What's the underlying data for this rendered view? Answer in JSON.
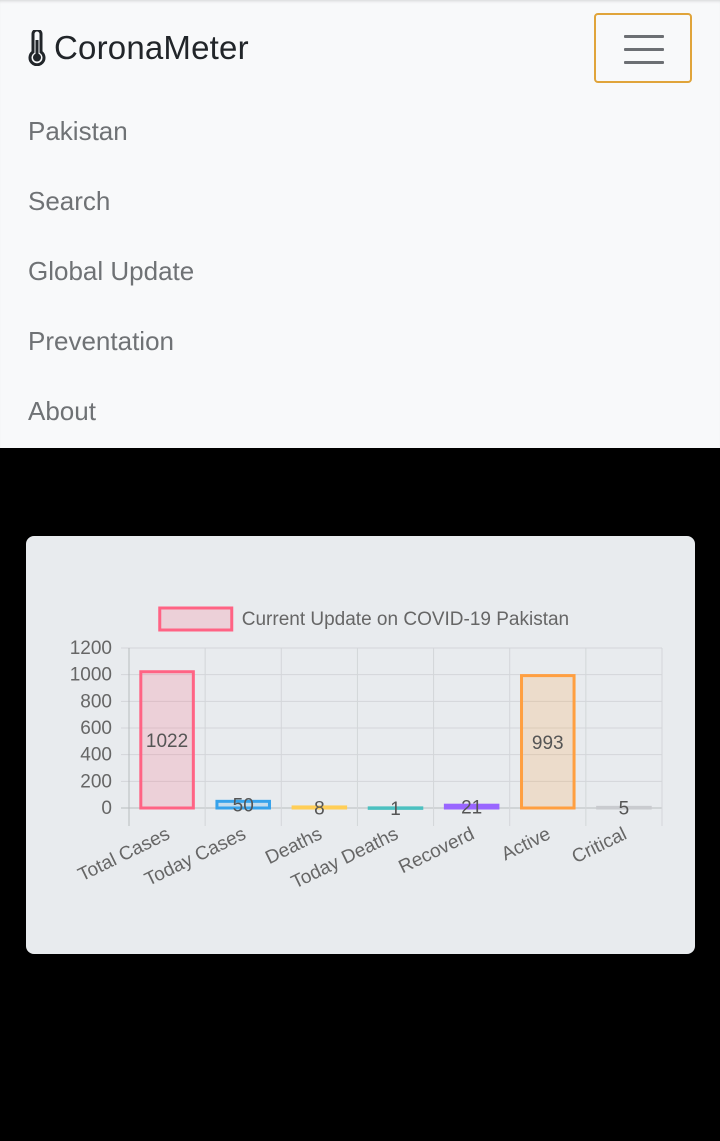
{
  "app": {
    "brand": "CoronaMeter",
    "brand_icon": "thermometer-icon",
    "menu_icon": "hamburger-menu-icon",
    "accent": "#e0a43a"
  },
  "nav": {
    "items": [
      {
        "label": "Pakistan"
      },
      {
        "label": "Search"
      },
      {
        "label": "Global Update"
      },
      {
        "label": "Preventation"
      },
      {
        "label": "About"
      }
    ]
  },
  "chart_data": {
    "type": "bar",
    "legend": "Current Update on COVID-19 Pakistan",
    "legend_position": "top",
    "categories": [
      "Total Cases",
      "Today Cases",
      "Deaths",
      "Today Deaths",
      "Recoverd",
      "Active",
      "Critical"
    ],
    "values": [
      1022,
      50,
      8,
      1,
      21,
      993,
      5
    ],
    "value_labels": [
      "1022",
      "50",
      "8",
      "1",
      "21",
      "993",
      "5"
    ],
    "bar_colors": [
      "#ff6384",
      "#36a2eb",
      "#ffce56",
      "#4bc0c0",
      "#9966ff",
      "#ff9f40",
      "#c9cbcf"
    ],
    "bar_fills": [
      "rgba(255,99,132,0.2)",
      "rgba(54,162,235,0.2)",
      "rgba(255,206,86,0.2)",
      "rgba(75,192,192,0.2)",
      "rgba(153,102,255,0.2)",
      "rgba(255,159,64,0.2)",
      "rgba(201,203,207,0.2)"
    ],
    "yticks": [
      "0",
      "200",
      "400",
      "600",
      "800",
      "1000",
      "1200"
    ],
    "ylim": [
      0,
      1200
    ],
    "grid": true
  }
}
